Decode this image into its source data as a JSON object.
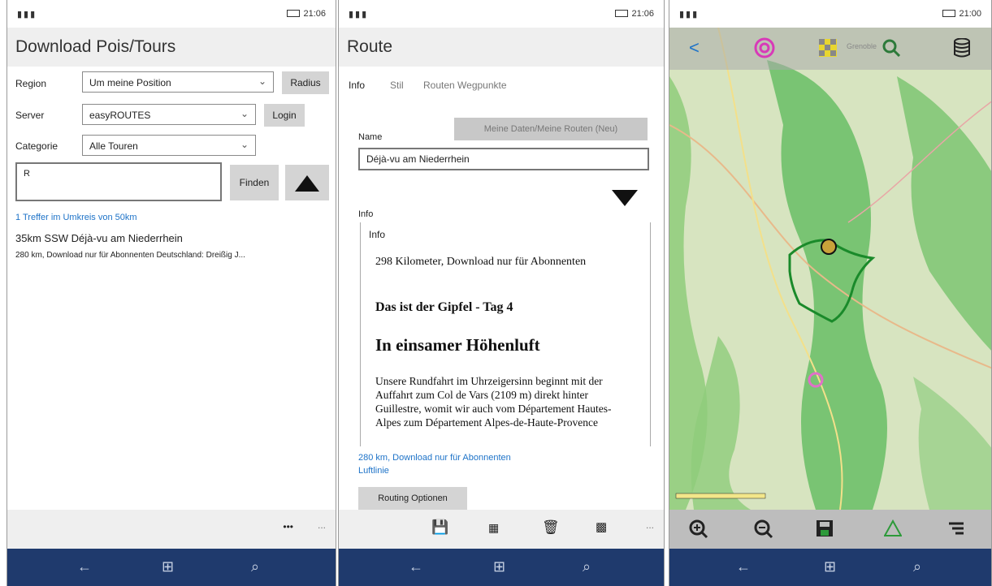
{
  "status": {
    "signal": "▮▮▮",
    "time_1": "21:06",
    "time_2": "21:06",
    "time_3": "21:00"
  },
  "screen1": {
    "title": "Download Pois/Tours",
    "region_label": "Region",
    "region_value": "Um meine Position",
    "radius_button": "Radius",
    "server_label": "Server",
    "server_value": "easyROUTES",
    "login_button": "Login",
    "category_label": "Categorie",
    "category_value": "Alle Touren",
    "search_value": "R",
    "find_button": "Finden",
    "results_count": "1 Treffer im Umkreis von 50km",
    "result_title": "35km SSW  Déjà-vu am Niederrhein",
    "result_desc": "280 km, Download nur für Abonnenten Deutschland: Dreißig J...",
    "appbar_dots": "•••",
    "appbar_more": "..."
  },
  "screen2": {
    "title": "Route",
    "tabs": [
      "Info",
      "Stil",
      "Routen Wegpunkte"
    ],
    "mydata_button": "Meine Daten/Meine Routen (Neu)",
    "name_label": "Name",
    "name_value": "Déjà-vu am Niederrhein",
    "info_label": "Info",
    "info_box_label": "Info",
    "info_line1": "298 Kilometer, Download nur für Abonnenten",
    "info_heading1": "Das ist der Gipfel - Tag 4",
    "info_heading2": "In einsamer Höhenluft",
    "info_paragraph": "Unsere Rundfahrt im Uhrzeigersinn beginnt mit der Auffahrt zum Col de Vars (2109 m) direkt hinter Guillestre, womit wir auch vom Département Hautes-Alpes zum Département Alpes-de-Haute-Provence",
    "footer_link1": "280 km, Download nur für Abonnenten",
    "footer_link2": "Luftlinie",
    "routing_button": "Routing Optionen",
    "appbar_more": "..."
  },
  "screen3": {
    "map_label_city": "Grenoble"
  },
  "nav": {
    "back": "←",
    "windows": "⊞",
    "search": "⌕"
  },
  "colors": {
    "navbar": "#1f3a6d",
    "link": "#1e73c8",
    "map_green": "#5fb85a",
    "route": "#1a8a2a"
  }
}
